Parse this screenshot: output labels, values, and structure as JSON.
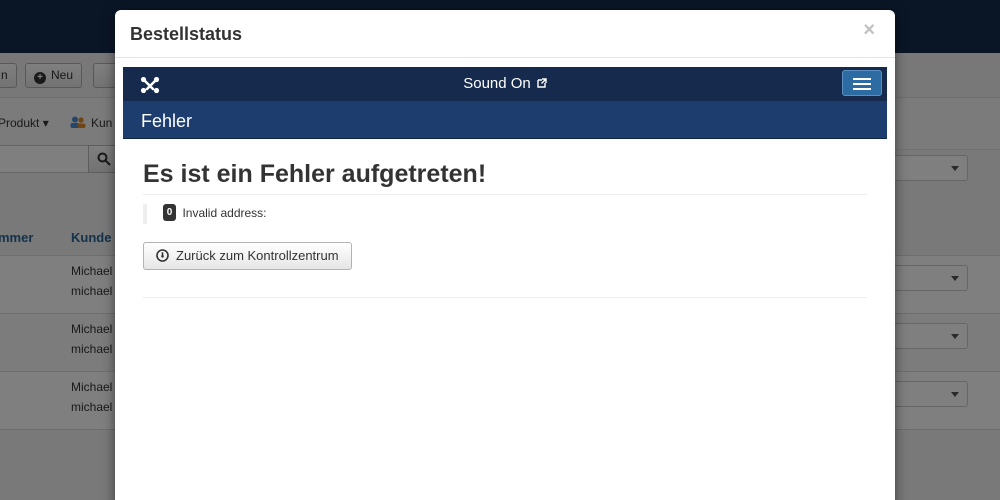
{
  "background": {
    "toolbar": {
      "partial_label": "n",
      "new_label": "Neu"
    },
    "submenu": {
      "product_label": "Produkt",
      "customer_label": "Kun"
    },
    "table": {
      "headers": {
        "number": "mmer",
        "customer": "Kunde"
      },
      "rows": [
        {
          "name": "Michael",
          "email": "michael"
        },
        {
          "name": "Michael",
          "email": "michael"
        },
        {
          "name": "Michael",
          "email": "michael"
        }
      ]
    }
  },
  "modal": {
    "title": "Bestellstatus",
    "close_symbol": "×",
    "navbar": {
      "site_name": "Sound On"
    },
    "subhead_title": "Fehler",
    "error_heading": "Es ist ein Fehler aufgetreten!",
    "error_code": "0",
    "error_message": "Invalid address:",
    "back_button_label": "Zurück zum Kontrollzentrum"
  },
  "colors": {
    "navbar": "#152a4c",
    "subhead": "#1d3d6e",
    "toggle": "#2d6ca2"
  }
}
